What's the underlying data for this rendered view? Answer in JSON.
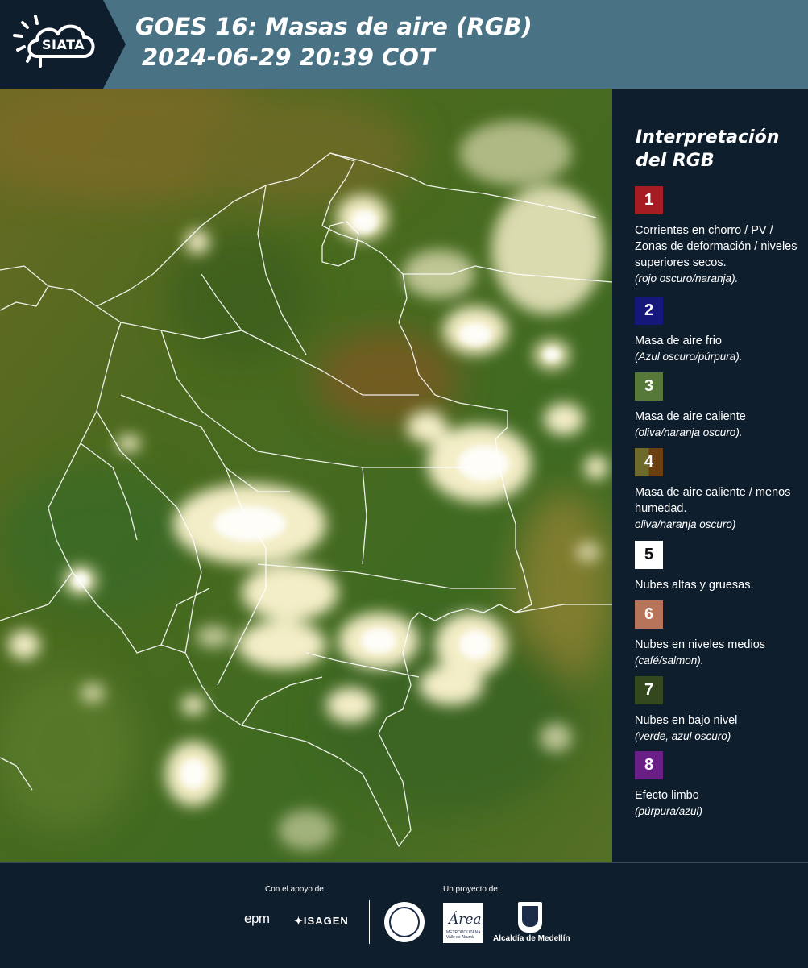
{
  "header": {
    "logo": "SIATA",
    "title_line1": "GOES 16: Masas de aire (RGB)",
    "title_line2": "2024-06-29 20:39 COT"
  },
  "map": {
    "icon": "satellite-airmass-rgb-map",
    "colors": {
      "background": "#4f6e1e",
      "cloud": "#f2ecc6",
      "border": "#ffffff"
    }
  },
  "legend": {
    "title_line1": "Interpretación",
    "title_line2": "del RGB",
    "items": [
      {
        "n": "1",
        "color": "#a51d23",
        "text": "Corrientes en chorro / PV / Zonas de deformación / niveles superiores secos.",
        "note": "(rojo oscuro/naranja)."
      },
      {
        "n": "2",
        "color": "#15187a",
        "text": "Masa de aire frio",
        "note": "(Azul oscuro/púrpura)."
      },
      {
        "n": "3",
        "color": "#56793a",
        "text": "Masa de aire caliente",
        "note": "(oliva/naranja oscuro)."
      },
      {
        "n": "4",
        "color": "#6e5a22",
        "text": "Masa de aire caliente / menos humedad.",
        "note": "oliva/naranja oscuro)"
      },
      {
        "n": "5",
        "color": "#ffffff",
        "text": "Nubes altas y gruesas.",
        "note": ""
      },
      {
        "n": "6",
        "color": "#b8745a",
        "text": "Nubes en niveles medios",
        "note": "(café/salmon)."
      },
      {
        "n": "7",
        "color": "#34481e",
        "text": "Nubes en bajo nivel",
        "note": "(verde, azul oscuro)"
      },
      {
        "n": "8",
        "color": "#6a1f86",
        "text": "Efecto limbo",
        "note": "(púrpura/azul)"
      }
    ]
  },
  "footer": {
    "support_label": "Con el apoyo de:",
    "project_label": "Un proyecto de:",
    "epm": "epm",
    "isagen": "ISAGEN",
    "area_logo": "Área",
    "area_sub": "METROPOLITANA Valle de Aburrá",
    "alcaldia": "Alcaldía de Medellín"
  }
}
